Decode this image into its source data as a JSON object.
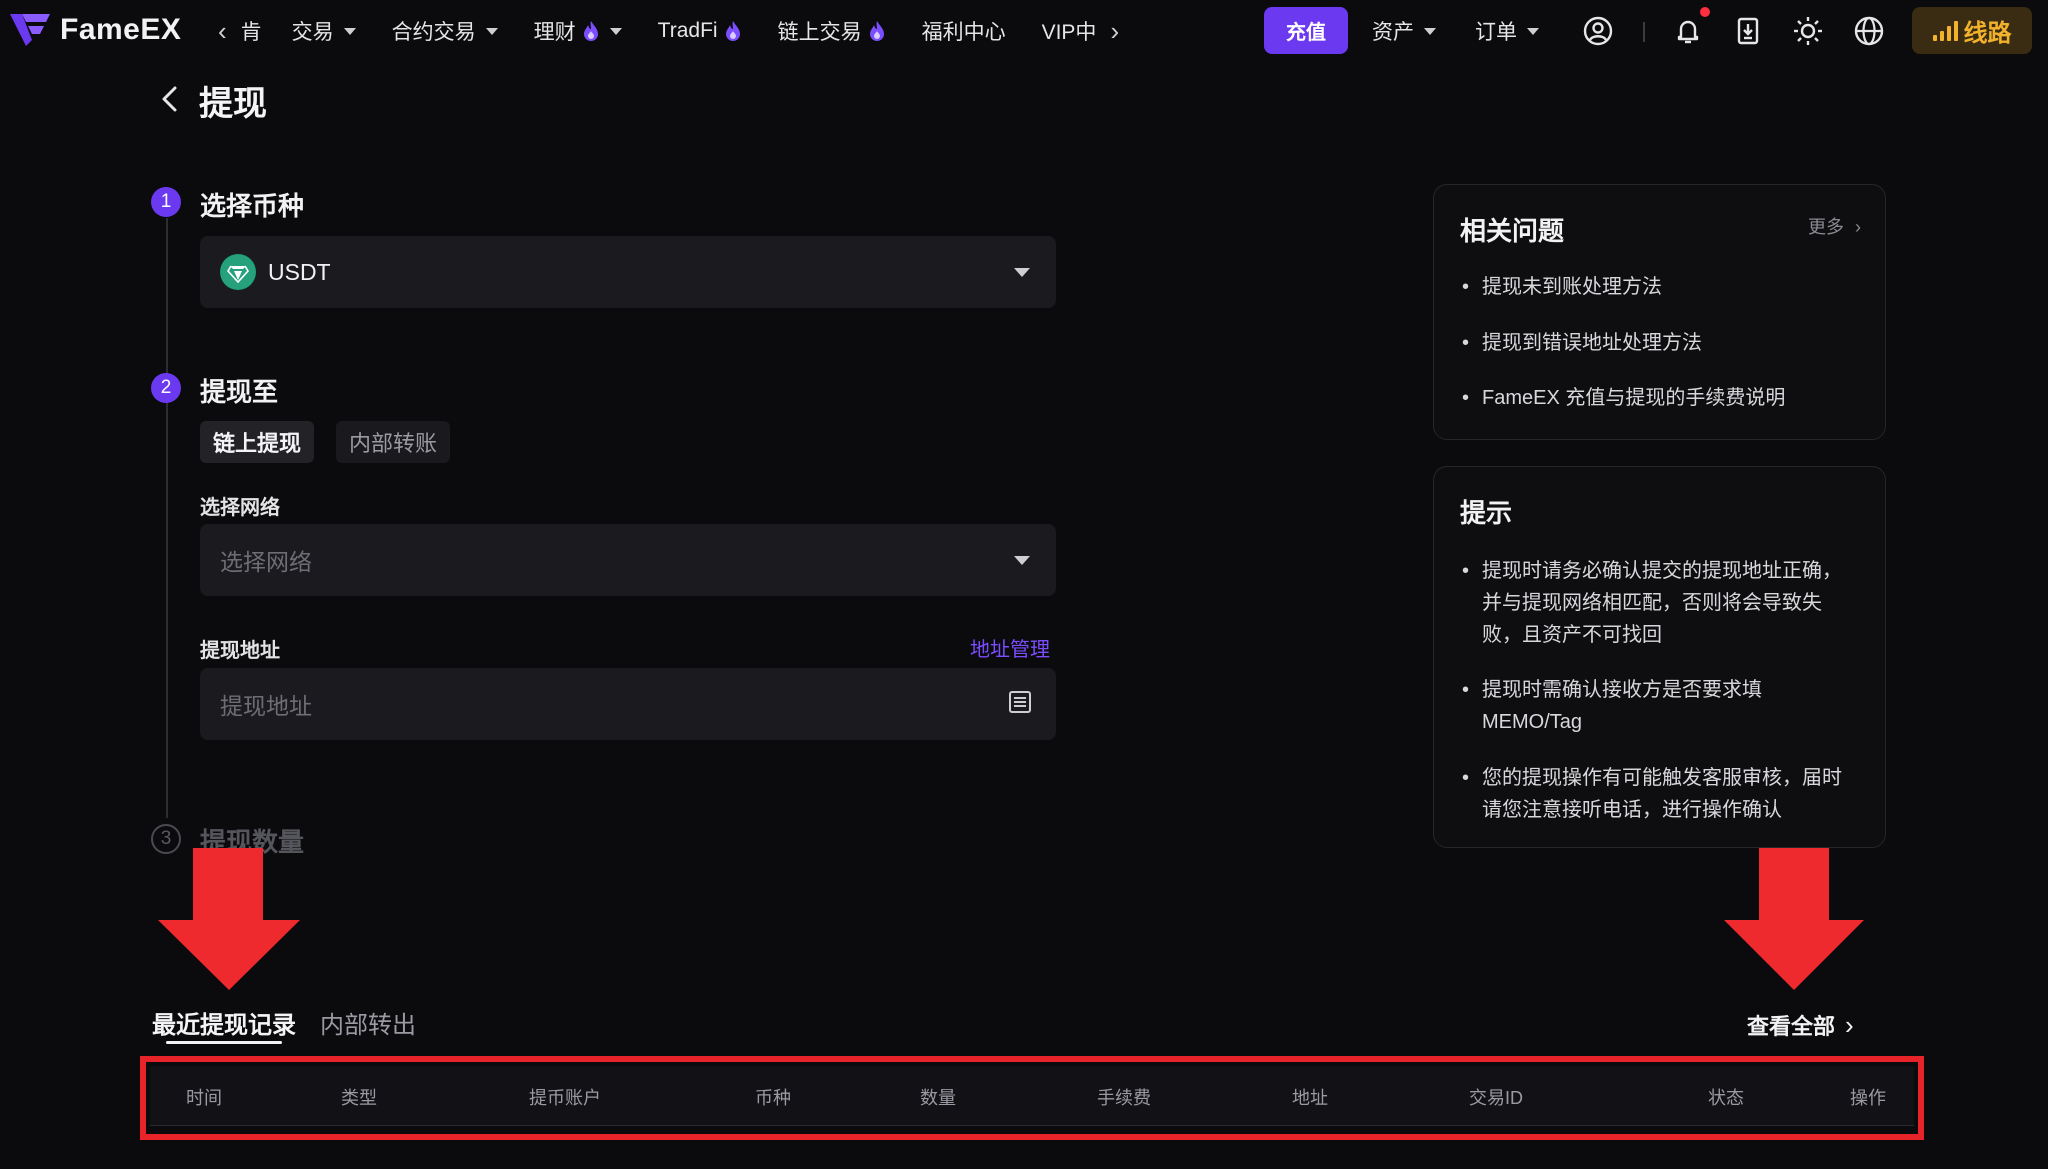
{
  "brand": {
    "name": "FameEX"
  },
  "nav": {
    "partial_item": "肯",
    "items": [
      {
        "label": "交易",
        "dropdown": true,
        "hot": false
      },
      {
        "label": "合约交易",
        "dropdown": true,
        "hot": false
      },
      {
        "label": "理财",
        "dropdown": true,
        "hot": true
      },
      {
        "label": "TradFi",
        "dropdown": false,
        "hot": true
      },
      {
        "label": "链上交易",
        "dropdown": false,
        "hot": true
      },
      {
        "label": "福利中心",
        "dropdown": false,
        "hot": false
      },
      {
        "label": "VIP中",
        "dropdown": false,
        "hot": false
      }
    ],
    "deposit_label": "充值",
    "assets_label": "资产",
    "orders_label": "订单",
    "route_label": "线路"
  },
  "page": {
    "title": "提现"
  },
  "steps": {
    "step1": {
      "num": "1",
      "title": "选择币种",
      "coin": "USDT"
    },
    "step2": {
      "num": "2",
      "title": "提现至",
      "tabs": [
        {
          "label": "链上提现",
          "active": true
        },
        {
          "label": "内部转账",
          "active": false
        }
      ],
      "network_label": "选择网络",
      "network_placeholder": "选择网络",
      "address_label": "提现地址",
      "address_mgmt": "地址管理",
      "address_placeholder": "提现地址"
    },
    "step3": {
      "num": "3",
      "title": "提现数量"
    }
  },
  "faq": {
    "title": "相关问题",
    "more": "更多",
    "items": [
      "提现未到账处理方法",
      "提现到错误地址处理方法",
      "FameEX 充值与提现的手续费说明"
    ]
  },
  "tips": {
    "title": "提示",
    "items": [
      "提现时请务必确认提交的提现地址正确，并与提现网络相匹配，否则将会导致失败，且资产不可找回",
      "提现时需确认接收方是否要求填MEMO/Tag",
      "您的提现操作有可能触发客服审核，届时请您注意接听电话，进行操作确认"
    ]
  },
  "records": {
    "tabs": [
      "最近提现记录",
      "内部转出"
    ],
    "view_all": "查看全部",
    "columns": [
      "时间",
      "类型",
      "提币账户",
      "币种",
      "数量",
      "手续费",
      "地址",
      "交易ID",
      "状态",
      "操作"
    ]
  },
  "colors": {
    "accent": "#6a39f0",
    "highlight_red": "#e8232a",
    "route_gold": "#f2b22c"
  }
}
